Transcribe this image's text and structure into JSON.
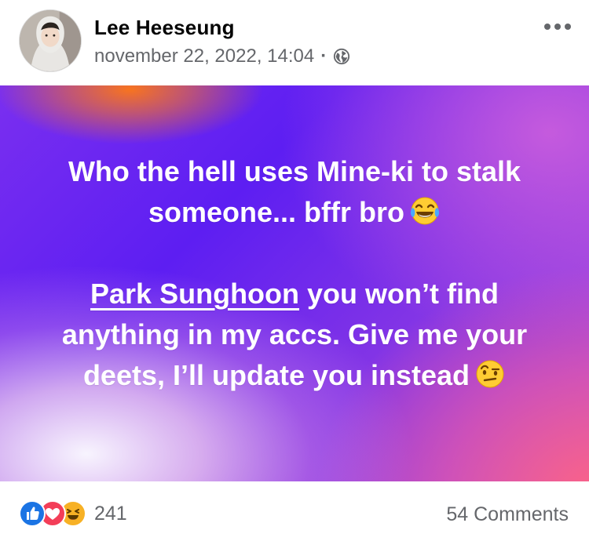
{
  "post": {
    "author": "Lee Heeseung",
    "timestamp": "november 22, 2022, 14:04",
    "separator": "·",
    "audience_icon": "globe-icon",
    "more_icon": "more-options-icon"
  },
  "content": {
    "line1_text": "Who the hell uses Mine-ki to stalk someone... bffr bro",
    "line1_emoji": "face-with-tears-of-joy-icon",
    "mention": "Park Sunghoon",
    "line2_text": " you won’t find anything in my accs. Give me your deets, I’ll update you instead",
    "line2_emoji": "face-with-raised-eyebrow-icon",
    "background_colors": [
      "#5d1ef2",
      "#b050d8",
      "#ff7814",
      "#ff6482",
      "#ffffff"
    ]
  },
  "footer": {
    "reactions": [
      "like-icon",
      "love-icon",
      "haha-icon"
    ],
    "reaction_count": "241",
    "comments_label": "54 Comments"
  }
}
